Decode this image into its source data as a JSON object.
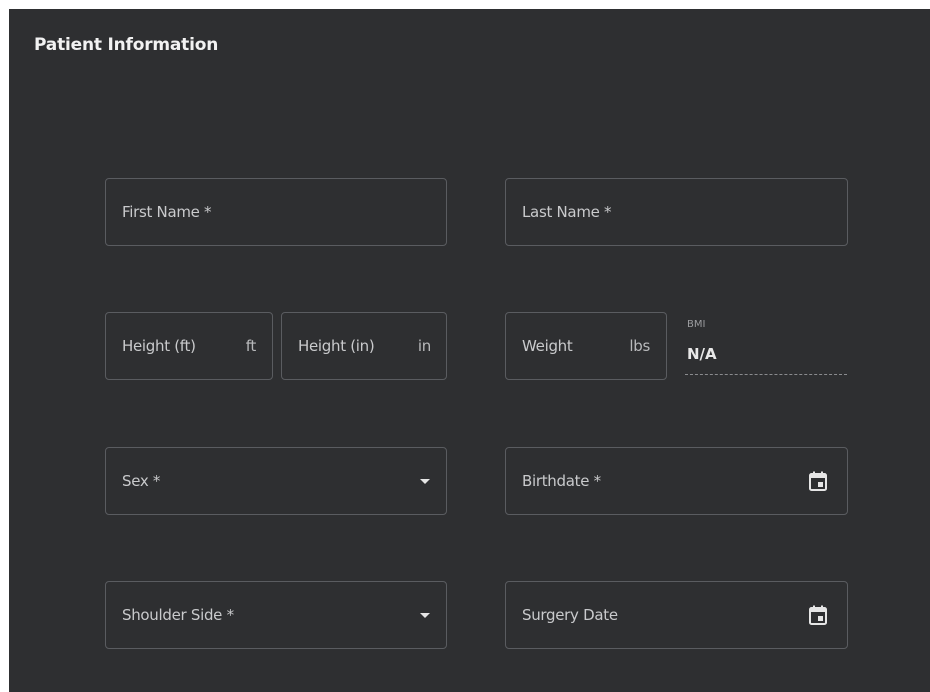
{
  "header": {
    "title": "Patient Information"
  },
  "form": {
    "first_name": {
      "label": "First Name *"
    },
    "last_name": {
      "label": "Last Name *"
    },
    "height_ft": {
      "label": "Height (ft)",
      "unit": "ft"
    },
    "height_in": {
      "label": "Height (in)",
      "unit": "in"
    },
    "weight": {
      "label": "Weight",
      "unit": "lbs"
    },
    "bmi": {
      "label": "BMI",
      "value": "N/A"
    },
    "sex": {
      "label": "Sex *",
      "icon": "chevron-down-icon"
    },
    "birthdate": {
      "label": "Birthdate *",
      "icon": "calendar-icon"
    },
    "shoulder_side": {
      "label": "Shoulder Side *",
      "icon": "chevron-down-icon"
    },
    "surgery_date": {
      "label": "Surgery Date",
      "icon": "calendar-icon"
    }
  },
  "colors": {
    "panel_bg": "#2e2f31",
    "field_border": "#5a5c60",
    "label_text": "#c9cacc",
    "title_text": "#f2f2f2"
  }
}
